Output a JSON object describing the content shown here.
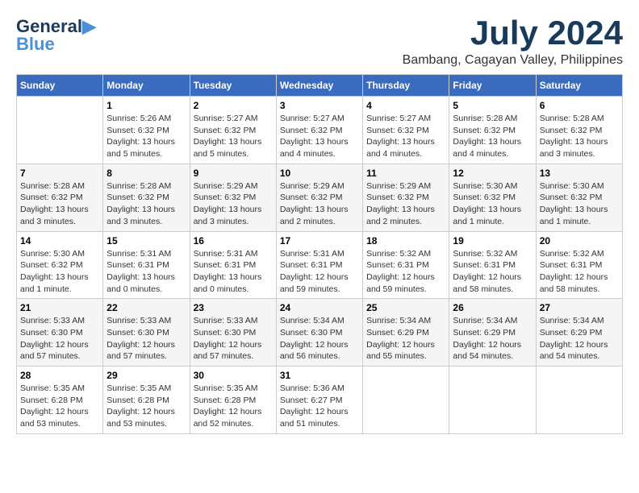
{
  "header": {
    "logo_line1": "General",
    "logo_line2": "Blue",
    "month_year": "July 2024",
    "location": "Bambang, Cagayan Valley, Philippines"
  },
  "days_of_week": [
    "Sunday",
    "Monday",
    "Tuesday",
    "Wednesday",
    "Thursday",
    "Friday",
    "Saturday"
  ],
  "weeks": [
    [
      {
        "day": "",
        "info": ""
      },
      {
        "day": "1",
        "info": "Sunrise: 5:26 AM\nSunset: 6:32 PM\nDaylight: 13 hours\nand 5 minutes."
      },
      {
        "day": "2",
        "info": "Sunrise: 5:27 AM\nSunset: 6:32 PM\nDaylight: 13 hours\nand 5 minutes."
      },
      {
        "day": "3",
        "info": "Sunrise: 5:27 AM\nSunset: 6:32 PM\nDaylight: 13 hours\nand 4 minutes."
      },
      {
        "day": "4",
        "info": "Sunrise: 5:27 AM\nSunset: 6:32 PM\nDaylight: 13 hours\nand 4 minutes."
      },
      {
        "day": "5",
        "info": "Sunrise: 5:28 AM\nSunset: 6:32 PM\nDaylight: 13 hours\nand 4 minutes."
      },
      {
        "day": "6",
        "info": "Sunrise: 5:28 AM\nSunset: 6:32 PM\nDaylight: 13 hours\nand 3 minutes."
      }
    ],
    [
      {
        "day": "7",
        "info": "Sunrise: 5:28 AM\nSunset: 6:32 PM\nDaylight: 13 hours\nand 3 minutes."
      },
      {
        "day": "8",
        "info": "Sunrise: 5:28 AM\nSunset: 6:32 PM\nDaylight: 13 hours\nand 3 minutes."
      },
      {
        "day": "9",
        "info": "Sunrise: 5:29 AM\nSunset: 6:32 PM\nDaylight: 13 hours\nand 3 minutes."
      },
      {
        "day": "10",
        "info": "Sunrise: 5:29 AM\nSunset: 6:32 PM\nDaylight: 13 hours\nand 2 minutes."
      },
      {
        "day": "11",
        "info": "Sunrise: 5:29 AM\nSunset: 6:32 PM\nDaylight: 13 hours\nand 2 minutes."
      },
      {
        "day": "12",
        "info": "Sunrise: 5:30 AM\nSunset: 6:32 PM\nDaylight: 13 hours\nand 1 minute."
      },
      {
        "day": "13",
        "info": "Sunrise: 5:30 AM\nSunset: 6:32 PM\nDaylight: 13 hours\nand 1 minute."
      }
    ],
    [
      {
        "day": "14",
        "info": "Sunrise: 5:30 AM\nSunset: 6:32 PM\nDaylight: 13 hours\nand 1 minute."
      },
      {
        "day": "15",
        "info": "Sunrise: 5:31 AM\nSunset: 6:31 PM\nDaylight: 13 hours\nand 0 minutes."
      },
      {
        "day": "16",
        "info": "Sunrise: 5:31 AM\nSunset: 6:31 PM\nDaylight: 13 hours\nand 0 minutes."
      },
      {
        "day": "17",
        "info": "Sunrise: 5:31 AM\nSunset: 6:31 PM\nDaylight: 12 hours\nand 59 minutes."
      },
      {
        "day": "18",
        "info": "Sunrise: 5:32 AM\nSunset: 6:31 PM\nDaylight: 12 hours\nand 59 minutes."
      },
      {
        "day": "19",
        "info": "Sunrise: 5:32 AM\nSunset: 6:31 PM\nDaylight: 12 hours\nand 58 minutes."
      },
      {
        "day": "20",
        "info": "Sunrise: 5:32 AM\nSunset: 6:31 PM\nDaylight: 12 hours\nand 58 minutes."
      }
    ],
    [
      {
        "day": "21",
        "info": "Sunrise: 5:33 AM\nSunset: 6:30 PM\nDaylight: 12 hours\nand 57 minutes."
      },
      {
        "day": "22",
        "info": "Sunrise: 5:33 AM\nSunset: 6:30 PM\nDaylight: 12 hours\nand 57 minutes."
      },
      {
        "day": "23",
        "info": "Sunrise: 5:33 AM\nSunset: 6:30 PM\nDaylight: 12 hours\nand 57 minutes."
      },
      {
        "day": "24",
        "info": "Sunrise: 5:34 AM\nSunset: 6:30 PM\nDaylight: 12 hours\nand 56 minutes."
      },
      {
        "day": "25",
        "info": "Sunrise: 5:34 AM\nSunset: 6:29 PM\nDaylight: 12 hours\nand 55 minutes."
      },
      {
        "day": "26",
        "info": "Sunrise: 5:34 AM\nSunset: 6:29 PM\nDaylight: 12 hours\nand 54 minutes."
      },
      {
        "day": "27",
        "info": "Sunrise: 5:34 AM\nSunset: 6:29 PM\nDaylight: 12 hours\nand 54 minutes."
      }
    ],
    [
      {
        "day": "28",
        "info": "Sunrise: 5:35 AM\nSunset: 6:28 PM\nDaylight: 12 hours\nand 53 minutes."
      },
      {
        "day": "29",
        "info": "Sunrise: 5:35 AM\nSunset: 6:28 PM\nDaylight: 12 hours\nand 53 minutes."
      },
      {
        "day": "30",
        "info": "Sunrise: 5:35 AM\nSunset: 6:28 PM\nDaylight: 12 hours\nand 52 minutes."
      },
      {
        "day": "31",
        "info": "Sunrise: 5:36 AM\nSunset: 6:27 PM\nDaylight: 12 hours\nand 51 minutes."
      },
      {
        "day": "",
        "info": ""
      },
      {
        "day": "",
        "info": ""
      },
      {
        "day": "",
        "info": ""
      }
    ]
  ]
}
